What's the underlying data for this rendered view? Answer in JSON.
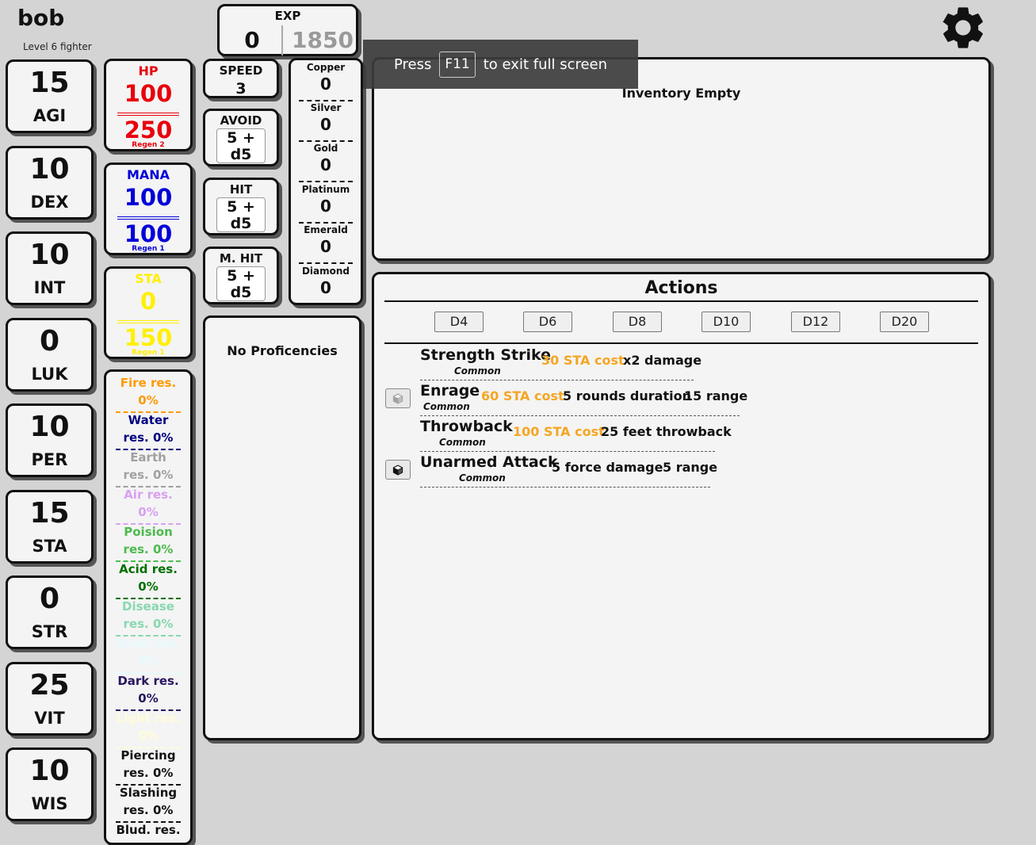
{
  "character": {
    "name": "bob",
    "subtitle": "Level 6 fighter"
  },
  "exp": {
    "label": "EXP",
    "current": "0",
    "max": "1850"
  },
  "fullscreen": {
    "press": "Press",
    "key": "F11",
    "rest": "to exit full screen"
  },
  "stats": [
    {
      "value": "15",
      "label": "AGI"
    },
    {
      "value": "10",
      "label": "DEX"
    },
    {
      "value": "10",
      "label": "INT"
    },
    {
      "value": "0",
      "label": "LUK"
    },
    {
      "value": "10",
      "label": "PER"
    },
    {
      "value": "15",
      "label": "STA"
    },
    {
      "value": "0",
      "label": "STR"
    },
    {
      "value": "25",
      "label": "VIT"
    },
    {
      "value": "10",
      "label": "WIS"
    }
  ],
  "vitals": {
    "hp": {
      "name": "HP",
      "current": "100",
      "max": "250",
      "regen": "Regen 2",
      "color": "#e8000b"
    },
    "mana": {
      "name": "MANA",
      "current": "100",
      "max": "100",
      "regen": "Regen 1",
      "color": "#0000d8"
    },
    "sta": {
      "name": "STA",
      "current": "0",
      "max": "150",
      "regen": "Regen 1",
      "color": "#ffef00"
    }
  },
  "resistances": [
    {
      "label": "Fire res. 0%",
      "color": "#ff9900"
    },
    {
      "label": "Water res. 0%",
      "color": "#000080"
    },
    {
      "label": "Earth res. 0%",
      "color": "#a0a0a0"
    },
    {
      "label": "Air res. 0%",
      "color": "#d8a0f0"
    },
    {
      "label": "Poision res. 0%",
      "color": "#4cbb4c"
    },
    {
      "label": "Acid res. 0%",
      "color": "#007000"
    },
    {
      "label": "Disease res. 0%",
      "color": "#88d8b0"
    },
    {
      "label": "Frost res. 0%",
      "color": "#e6fbff"
    },
    {
      "label": "Dark res. 0%",
      "color": "#2a1660"
    },
    {
      "label": "Light res. 0%",
      "color": "#fffcd8"
    },
    {
      "label": "Piercing res. 0%",
      "color": "#111111"
    },
    {
      "label": "Slashing res. 0%",
      "color": "#111111"
    },
    {
      "label": "Blud. res. 0%",
      "color": "#111111"
    }
  ],
  "combat": {
    "speed": {
      "label": "SPEED",
      "value": "3"
    },
    "avoid": {
      "label": "AVOID",
      "l1": "5 +",
      "l2": "d5"
    },
    "hit": {
      "label": "HIT",
      "l1": "5 +",
      "l2": "d5"
    },
    "mhit": {
      "label": "M. HIT",
      "l1": "5 +",
      "l2": "d5"
    }
  },
  "currency": [
    {
      "name": "Copper",
      "value": "0"
    },
    {
      "name": "Silver",
      "value": "0"
    },
    {
      "name": "Gold",
      "value": "0"
    },
    {
      "name": "Platinum",
      "value": "0"
    },
    {
      "name": "Emerald",
      "value": "0"
    },
    {
      "name": "Diamond",
      "value": "0"
    }
  ],
  "proficiencies": {
    "text": "No Proficencies"
  },
  "inventory": {
    "text": "Inventory Empty"
  },
  "actions": {
    "title": "Actions",
    "dice": [
      "D4",
      "D6",
      "D8",
      "D10",
      "D12",
      "D20"
    ],
    "list": [
      {
        "name": "Strength Strike",
        "rarity": "Common",
        "cost": "30 STA cost",
        "effects": [
          "x2 damage"
        ]
      },
      {
        "name": "Enrage",
        "rarity": "Common",
        "cost": "60 STA cost",
        "effects": [
          "5 rounds duration",
          "15 range"
        ]
      },
      {
        "name": "Throwback",
        "rarity": "Common",
        "cost": "100 STA cost",
        "effects": [
          "25 feet throwback"
        ]
      },
      {
        "name": "Unarmed Attack",
        "rarity": "Common",
        "cost": "",
        "effects": [
          "5 force damage",
          "5 range"
        ]
      }
    ]
  }
}
